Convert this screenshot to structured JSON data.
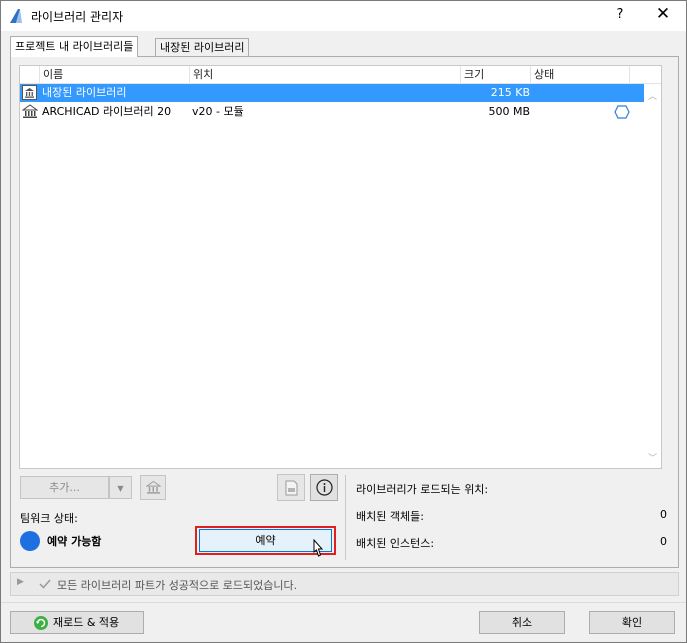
{
  "window": {
    "title": "라이브러리 관리자",
    "help": "?",
    "close": "✕"
  },
  "tabs": [
    "프로젝트 내 라이브러리들",
    "내장된 라이브러리"
  ],
  "table": {
    "columns": [
      "이름",
      "위치",
      "크기",
      "상태"
    ],
    "rows": [
      {
        "name": "내장된 라이브러리",
        "location": "",
        "size": "215 KB",
        "status": ""
      },
      {
        "name": "ARCHICAD 라이브러리 20",
        "location": "v20 - 모듈",
        "size": "500 MB",
        "status": "hexagon-icon"
      }
    ]
  },
  "controls": {
    "add_label": "추가...",
    "teamwork_label": "팀워크 상태:",
    "reserve_status": "예약 가능함",
    "reserve_button": "예약"
  },
  "info": {
    "load_location_label": "라이브러리가 로드되는 위치:",
    "placed_objects_label": "배치된 객체들:",
    "placed_objects_value": "0",
    "placed_instances_label": "배치된 인스턴스:",
    "placed_instances_value": "0"
  },
  "status_message": "모든 라이브러리 파트가 성공적으로 로드되었습니다.",
  "footer": {
    "reload_label": "재로드 & 적용",
    "cancel_label": "취소",
    "ok_label": "확인"
  },
  "colors": {
    "selection": "#3399ff",
    "reserve_dot": "#1e6fe0",
    "highlight_border": "#e0201f"
  }
}
